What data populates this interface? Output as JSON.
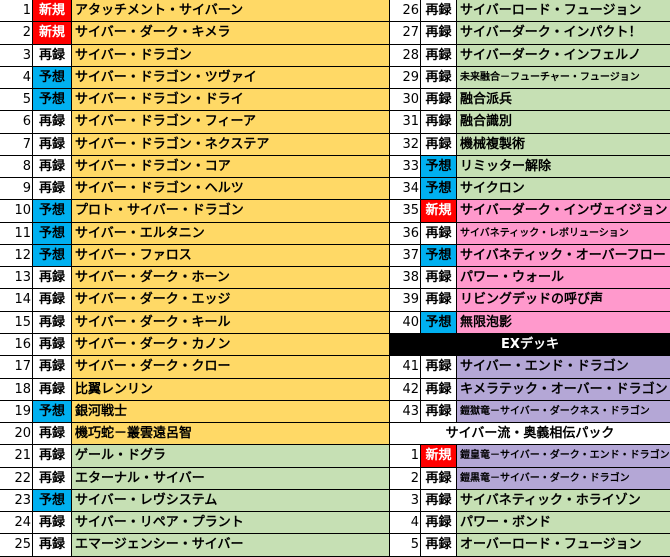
{
  "colors": {
    "new_tag": "#ff0000",
    "forecast_tag": "#00b0f0",
    "yellow": "#ffd966",
    "green": "#c6e0b4",
    "pink": "#ff99cc",
    "purple": "#b4a7d6",
    "header_black": "#000000"
  },
  "left": [
    {
      "no": "1",
      "tag": "新規",
      "kind": "new",
      "name": "アタッチメント・サイバーン",
      "color": "#ffd966"
    },
    {
      "no": "2",
      "tag": "新規",
      "kind": "new",
      "name": "サイバー・ダーク・キメラ",
      "color": "#ffd966"
    },
    {
      "no": "3",
      "tag": "再録",
      "kind": "reprint",
      "name": "サイバー・ドラゴン",
      "color": "#ffd966"
    },
    {
      "no": "4",
      "tag": "予想",
      "kind": "forecast",
      "name": "サイバー・ドラゴン・ツヴァイ",
      "color": "#ffd966"
    },
    {
      "no": "5",
      "tag": "予想",
      "kind": "forecast",
      "name": "サイバー・ドラゴン・ドライ",
      "color": "#ffd966"
    },
    {
      "no": "6",
      "tag": "再録",
      "kind": "reprint",
      "name": "サイバー・ドラゴン・フィーア",
      "color": "#ffd966"
    },
    {
      "no": "7",
      "tag": "再録",
      "kind": "reprint",
      "name": "サイバー・ドラゴン・ネクステア",
      "color": "#ffd966"
    },
    {
      "no": "8",
      "tag": "再録",
      "kind": "reprint",
      "name": "サイバー・ドラゴン・コア",
      "color": "#ffd966"
    },
    {
      "no": "9",
      "tag": "再録",
      "kind": "reprint",
      "name": "サイバー・ドラゴン・ヘルツ",
      "color": "#ffd966"
    },
    {
      "no": "10",
      "tag": "予想",
      "kind": "forecast",
      "name": "プロト・サイバー・ドラゴン",
      "color": "#ffd966"
    },
    {
      "no": "11",
      "tag": "予想",
      "kind": "forecast",
      "name": "サイバー・エルタニン",
      "color": "#ffd966"
    },
    {
      "no": "12",
      "tag": "予想",
      "kind": "forecast",
      "name": "サイバー・ファロス",
      "color": "#ffd966"
    },
    {
      "no": "13",
      "tag": "再録",
      "kind": "reprint",
      "name": "サイバー・ダーク・ホーン",
      "color": "#ffd966"
    },
    {
      "no": "14",
      "tag": "再録",
      "kind": "reprint",
      "name": "サイバー・ダーク・エッジ",
      "color": "#ffd966"
    },
    {
      "no": "15",
      "tag": "再録",
      "kind": "reprint",
      "name": "サイバー・ダーク・キール",
      "color": "#ffd966"
    },
    {
      "no": "16",
      "tag": "再録",
      "kind": "reprint",
      "name": "サイバー・ダーク・カノン",
      "color": "#ffd966"
    },
    {
      "no": "17",
      "tag": "再録",
      "kind": "reprint",
      "name": "サイバー・ダーク・クロー",
      "color": "#ffd966"
    },
    {
      "no": "18",
      "tag": "再録",
      "kind": "reprint",
      "name": "比翼レンリン",
      "color": "#ffd966"
    },
    {
      "no": "19",
      "tag": "予想",
      "kind": "forecast",
      "name": "銀河戦士",
      "color": "#ffd966"
    },
    {
      "no": "20",
      "tag": "再録",
      "kind": "reprint",
      "name": "機巧蛇－叢雲遠呂智",
      "color": "#ffd966"
    },
    {
      "no": "21",
      "tag": "再録",
      "kind": "reprint",
      "name": "ゲール・ドグラ",
      "color": "#c6e0b4"
    },
    {
      "no": "22",
      "tag": "再録",
      "kind": "reprint",
      "name": "エターナル・サイバー",
      "color": "#c6e0b4"
    },
    {
      "no": "23",
      "tag": "予想",
      "kind": "forecast",
      "name": "サイバー・レヴシステム",
      "color": "#c6e0b4"
    },
    {
      "no": "24",
      "tag": "再録",
      "kind": "reprint",
      "name": "サイバー・リペア・プラント",
      "color": "#c6e0b4"
    },
    {
      "no": "25",
      "tag": "再録",
      "kind": "reprint",
      "name": "エマージェンシー・サイバー",
      "color": "#c6e0b4"
    }
  ],
  "right": [
    {
      "type": "card",
      "no": "26",
      "tag": "再録",
      "kind": "reprint",
      "name": "サイバーロード・フュージョン",
      "color": "#c6e0b4",
      "small": false
    },
    {
      "type": "card",
      "no": "27",
      "tag": "再録",
      "kind": "reprint",
      "name": "サイバーダーク・インパクト！",
      "color": "#c6e0b4",
      "small": false
    },
    {
      "type": "card",
      "no": "28",
      "tag": "再録",
      "kind": "reprint",
      "name": "サイバーダーク・インフェルノ",
      "color": "#c6e0b4",
      "small": false
    },
    {
      "type": "card",
      "no": "29",
      "tag": "再録",
      "kind": "reprint",
      "name": "未来融合－フューチャー・フュージョン",
      "color": "#c6e0b4",
      "small": true
    },
    {
      "type": "card",
      "no": "30",
      "tag": "再録",
      "kind": "reprint",
      "name": "融合派兵",
      "color": "#c6e0b4",
      "small": false
    },
    {
      "type": "card",
      "no": "31",
      "tag": "再録",
      "kind": "reprint",
      "name": "融合識別",
      "color": "#c6e0b4",
      "small": false
    },
    {
      "type": "card",
      "no": "32",
      "tag": "再録",
      "kind": "reprint",
      "name": "機械複製術",
      "color": "#c6e0b4",
      "small": false
    },
    {
      "type": "card",
      "no": "33",
      "tag": "予想",
      "kind": "forecast",
      "name": "リミッター解除",
      "color": "#c6e0b4",
      "small": false
    },
    {
      "type": "card",
      "no": "34",
      "tag": "予想",
      "kind": "forecast",
      "name": "サイクロン",
      "color": "#c6e0b4",
      "small": false
    },
    {
      "type": "card",
      "no": "35",
      "tag": "新規",
      "kind": "new",
      "name": "サイバーダーク・インヴェイジョン",
      "color": "#ff99cc",
      "small": false
    },
    {
      "type": "card",
      "no": "36",
      "tag": "再録",
      "kind": "reprint",
      "name": "サイバネティック・レボリューション",
      "color": "#ff99cc",
      "small": true
    },
    {
      "type": "card",
      "no": "37",
      "tag": "予想",
      "kind": "forecast",
      "name": "サイバネティック・オーバーフロー",
      "color": "#ff99cc",
      "small": false
    },
    {
      "type": "card",
      "no": "38",
      "tag": "再録",
      "kind": "reprint",
      "name": "パワー・ウォール",
      "color": "#ff99cc",
      "small": false
    },
    {
      "type": "card",
      "no": "39",
      "tag": "再録",
      "kind": "reprint",
      "name": "リビングデッドの呼び声",
      "color": "#ff99cc",
      "small": false
    },
    {
      "type": "card",
      "no": "40",
      "tag": "予想",
      "kind": "forecast",
      "name": "無限泡影",
      "color": "#ff99cc",
      "small": false
    },
    {
      "type": "header-black",
      "text": "EXデッキ"
    },
    {
      "type": "card",
      "no": "41",
      "tag": "再録",
      "kind": "reprint",
      "name": "サイバー・エンド・ドラゴン",
      "color": "#b4a7d6",
      "small": false
    },
    {
      "type": "card",
      "no": "42",
      "tag": "再録",
      "kind": "reprint",
      "name": "キメラテック・オーバー・ドラゴン",
      "color": "#b4a7d6",
      "small": false
    },
    {
      "type": "card",
      "no": "43",
      "tag": "再録",
      "kind": "reprint",
      "name": "鎧獄竜－サイバー・ダークネス・ドラゴン",
      "color": "#b4a7d6",
      "small": true
    },
    {
      "type": "header-white",
      "text": "サイバー流・奥義相伝パック"
    },
    {
      "type": "card",
      "no": "1",
      "tag": "新規",
      "kind": "new",
      "name": "鎧皇竜－サイバー・ダーク・エンド・ドラゴン",
      "color": "#b4a7d6",
      "small": true
    },
    {
      "type": "card",
      "no": "2",
      "tag": "再録",
      "kind": "reprint",
      "name": "鎧黒竜－サイバー・ダーク・ドラゴン",
      "color": "#b4a7d6",
      "small": true
    },
    {
      "type": "card",
      "no": "3",
      "tag": "再録",
      "kind": "reprint",
      "name": "サイバネティック・ホライゾン",
      "color": "#c6e0b4",
      "small": false
    },
    {
      "type": "card",
      "no": "4",
      "tag": "再録",
      "kind": "reprint",
      "name": "パワー・ボンド",
      "color": "#c6e0b4",
      "small": false
    },
    {
      "type": "card",
      "no": "5",
      "tag": "再録",
      "kind": "reprint",
      "name": "オーバーロード・フュージョン",
      "color": "#c6e0b4",
      "small": false
    }
  ]
}
